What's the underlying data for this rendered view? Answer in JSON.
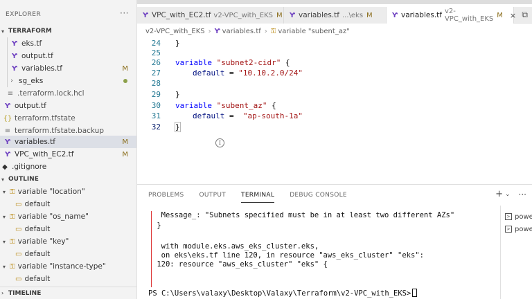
{
  "sidebar": {
    "explorer_title": "EXPLORER",
    "more_label": "···",
    "folder_title": "TERRAFORM",
    "files": [
      {
        "name": "eks.tf",
        "icon": "terraform-icon",
        "badge": ""
      },
      {
        "name": "output.tf",
        "icon": "terraform-icon",
        "badge": ""
      },
      {
        "name": "variables.tf",
        "icon": "terraform-icon",
        "badge": "M"
      },
      {
        "name": "sg_eks",
        "icon": "chevron-right-icon",
        "badge": "dot"
      },
      {
        "name": ".terraform.lock.hcl",
        "icon": "file-icon",
        "badge": ""
      },
      {
        "name": "output.tf",
        "icon": "terraform-icon",
        "badge": ""
      },
      {
        "name": "terraform.tfstate",
        "icon": "json-icon",
        "badge": ""
      },
      {
        "name": "terraform.tfstate.backup",
        "icon": "file-icon",
        "badge": ""
      },
      {
        "name": "variables.tf",
        "icon": "terraform-icon",
        "badge": "M"
      },
      {
        "name": "VPC_with_EC2.tf",
        "icon": "terraform-icon",
        "badge": "M"
      },
      {
        "name": ".gitignore",
        "icon": "git-icon",
        "badge": ""
      }
    ],
    "outline_title": "OUTLINE",
    "outline": [
      {
        "label": "variable \"location\"",
        "child": "default"
      },
      {
        "label": "variable \"os_name\"",
        "child": "default"
      },
      {
        "label": "variable \"key\"",
        "child": "default"
      },
      {
        "label": "variable \"instance-type\"",
        "child": "default"
      }
    ],
    "timeline_title": "TIMELINE"
  },
  "tabs": [
    {
      "name": "VPC_with_EC2.tf",
      "desc": "v2-VPC_with_EKS",
      "mod": "M"
    },
    {
      "name": "variables.tf",
      "desc": "...\\eks",
      "mod": "M"
    },
    {
      "name": "variables.tf",
      "desc": "v2-VPC_with_EKS",
      "mod": "M",
      "close": "×"
    }
  ],
  "breadcrumb": {
    "folder": "v2-VPC_with_EKS",
    "file": "variables.tf",
    "symbol": "variable \"subent_az\""
  },
  "editor": {
    "lines": [
      {
        "n": "24",
        "text": "}"
      },
      {
        "n": "25",
        "text": ""
      },
      {
        "n": "26",
        "kw": "variable",
        "str": "\"subnet2-cidr\"",
        "tail": " {"
      },
      {
        "n": "27",
        "attr": "default",
        "eq": " = ",
        "val": "\"10.10.2.0/24\""
      },
      {
        "n": "28",
        "text": ""
      },
      {
        "n": "29",
        "text": "}"
      },
      {
        "n": "30",
        "kw": "variable",
        "str": "\"subent_az\"",
        "tail": " {"
      },
      {
        "n": "31",
        "attr": "default",
        "eq": " =  ",
        "val": "\"ap-south-1a\""
      },
      {
        "n": "32",
        "text": "}"
      }
    ]
  },
  "panel": {
    "tabs": [
      "PROBLEMS",
      "OUTPUT",
      "TERMINAL",
      "DEBUG CONSOLE"
    ],
    "active_tab": "TERMINAL",
    "add_label": "+",
    "terminal_lines": [
      "  Message_: \"Subnets specified must be in at least two different AZs\"",
      " }",
      "",
      "  with module.eks.aws_eks_cluster.eks,",
      "  on eks\\eks.tf line 120, in resource \"aws_eks_cluster\" \"eks\":",
      " 120: resource \"aws_eks_cluster\" \"eks\" {"
    ],
    "prompt": "PS C:\\Users\\valaxy\\Desktop\\Valaxy\\Terraform\\v2-VPC_with_EKS>",
    "terminals": [
      "powe",
      "powe"
    ]
  }
}
